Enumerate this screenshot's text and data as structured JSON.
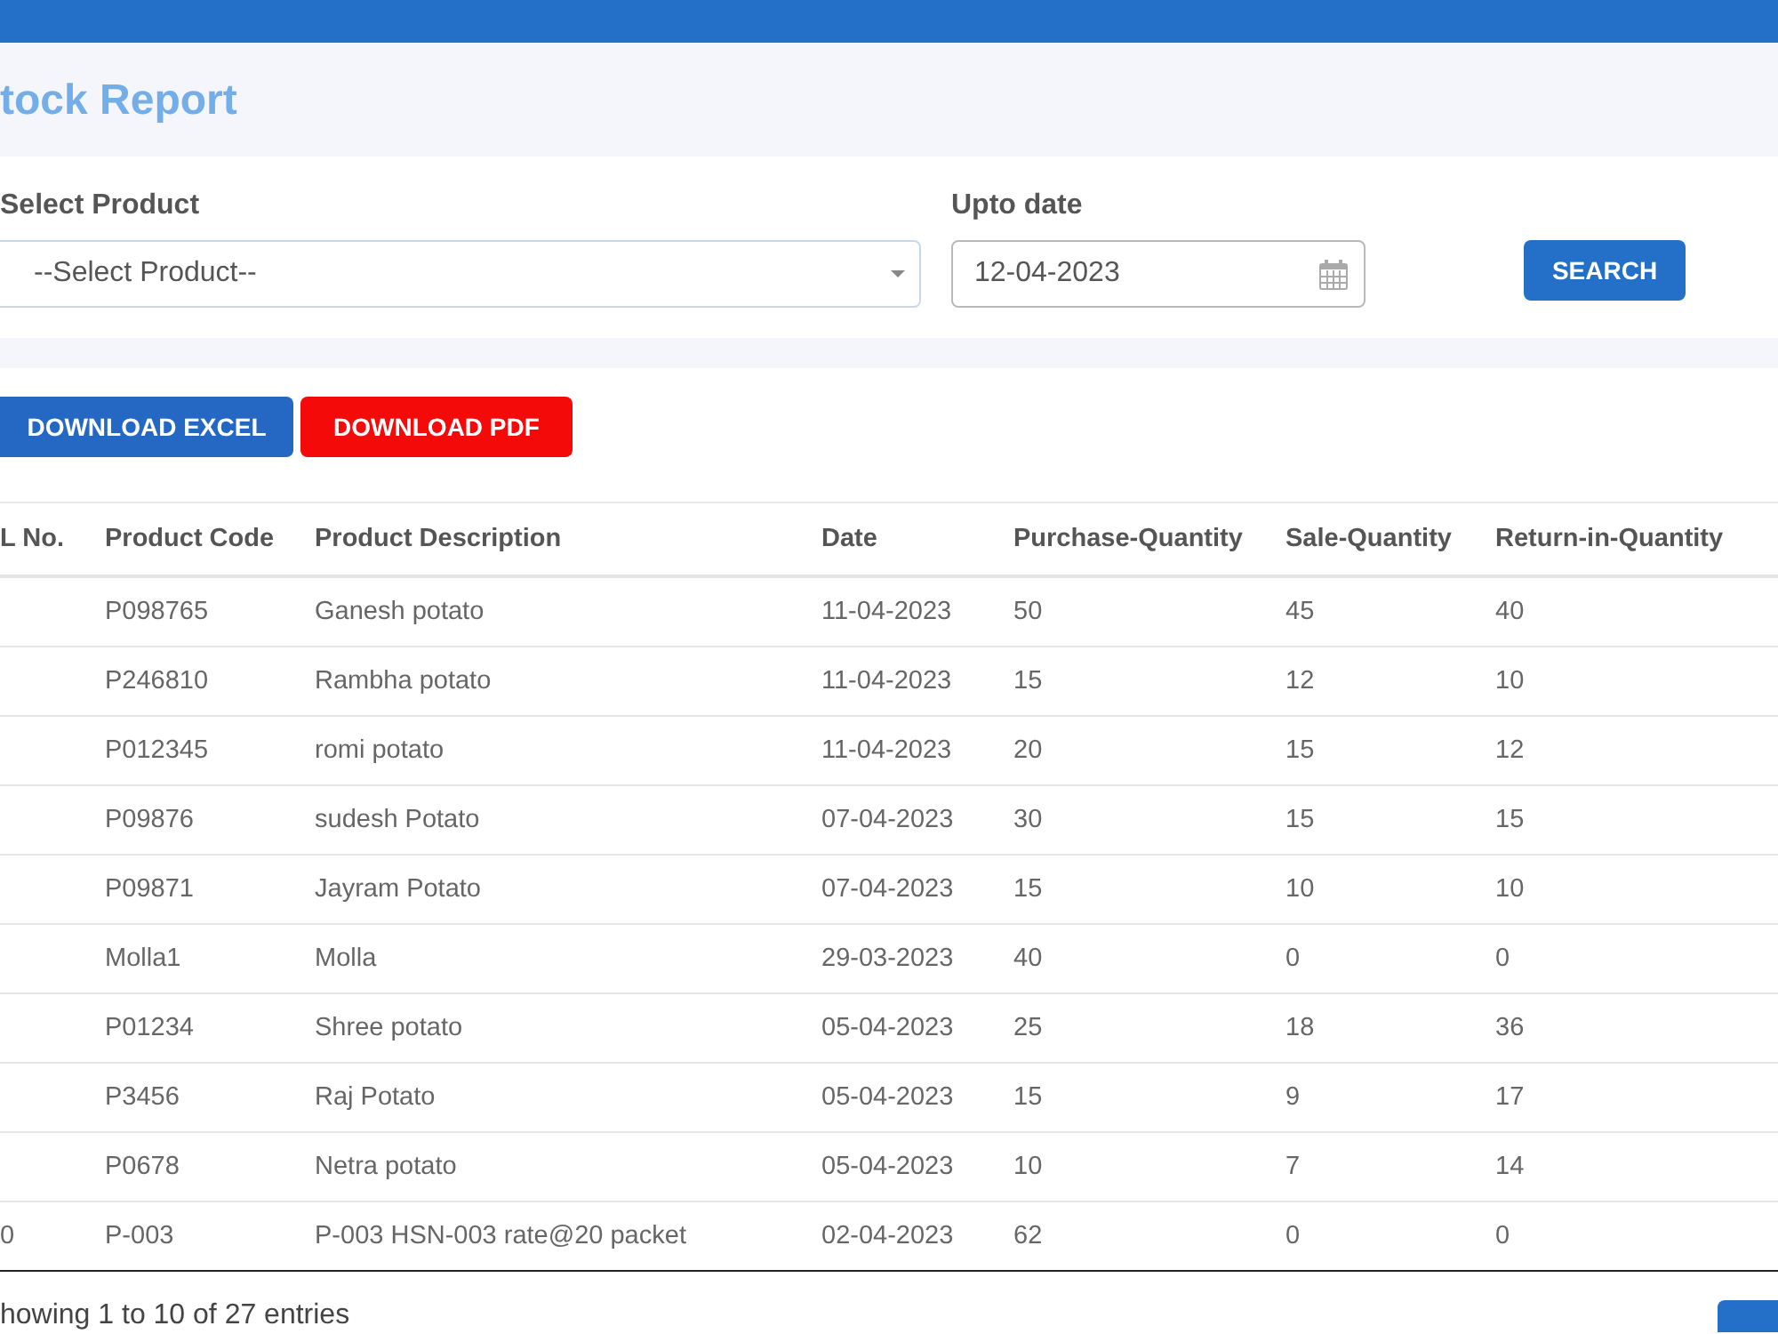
{
  "page_title": "tock Report",
  "filters": {
    "product": {
      "label": "Select Product",
      "value": "--Select Product--"
    },
    "date": {
      "label": "Upto date",
      "value": "12-04-2023"
    },
    "search_button": "SEARCH"
  },
  "export_buttons": [
    {
      "kind": "excel",
      "label": "DOWNLOAD EXCEL"
    },
    {
      "kind": "pdf",
      "label": "DOWNLOAD PDF"
    }
  ],
  "table": {
    "columns": [
      "L No.",
      "Product Code",
      "Product Description",
      "Date",
      "Purchase-Quantity",
      "Sale-Quantity",
      "Return-in-Quantity"
    ],
    "rows": [
      {
        "product_code": "P098765",
        "product_description": "Ganesh potato",
        "date": "11-04-2023",
        "purchase_quantity": "50",
        "sale_quantity": "45",
        "return_in_quantity": "40"
      },
      {
        "product_code": "P246810",
        "product_description": "Rambha potato",
        "date": "11-04-2023",
        "purchase_quantity": "15",
        "sale_quantity": "12",
        "return_in_quantity": "10"
      },
      {
        "product_code": "P012345",
        "product_description": "romi potato",
        "date": "11-04-2023",
        "purchase_quantity": "20",
        "sale_quantity": "15",
        "return_in_quantity": "12"
      },
      {
        "product_code": "P09876",
        "product_description": "sudesh Potato",
        "date": "07-04-2023",
        "purchase_quantity": "30",
        "sale_quantity": "15",
        "return_in_quantity": "15"
      },
      {
        "product_code": "P09871",
        "product_description": "Jayram Potato",
        "date": "07-04-2023",
        "purchase_quantity": "15",
        "sale_quantity": "10",
        "return_in_quantity": "10"
      },
      {
        "product_code": "Molla1",
        "product_description": "Molla",
        "date": "29-03-2023",
        "purchase_quantity": "40",
        "sale_quantity": "0",
        "return_in_quantity": "0"
      },
      {
        "product_code": "P01234",
        "product_description": "Shree potato",
        "date": "05-04-2023",
        "purchase_quantity": "25",
        "sale_quantity": "18",
        "return_in_quantity": "36"
      },
      {
        "product_code": "P3456",
        "product_description": "Raj Potato",
        "date": "05-04-2023",
        "purchase_quantity": "15",
        "sale_quantity": "9",
        "return_in_quantity": "17"
      },
      {
        "product_code": "P0678",
        "product_description": "Netra potato",
        "date": "05-04-2023",
        "purchase_quantity": "10",
        "sale_quantity": "7",
        "return_in_quantity": "14"
      },
      {
        "column_1": "0",
        "product_code": "P-003",
        "product_description": "P-003 HSN-003 rate@20 packet",
        "date": "02-04-2023",
        "purchase_quantity": "62",
        "sale_quantity": "0",
        "return_in_quantity": "0"
      }
    ]
  },
  "footer": {
    "info": "howing 1 to 10 of 27 entries"
  }
}
